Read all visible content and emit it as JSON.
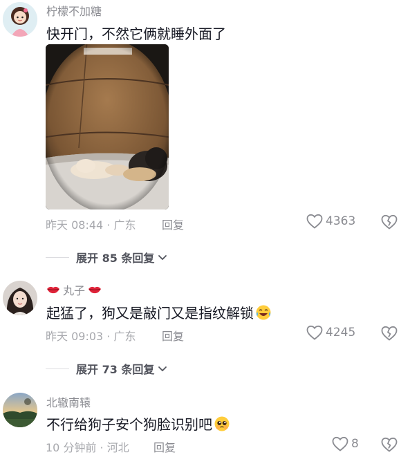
{
  "comments": [
    {
      "username": "柠檬不加糖",
      "text": "快开门，不然它俩就睡外面了",
      "time": "昨天 08:44",
      "location": "· 广东",
      "reply_label": "回复",
      "likes": "4363",
      "expand_label": "展开 85 条回复",
      "avatar_icon": "cartoon-girl-avatar-icon",
      "has_image": true
    },
    {
      "username": "丸子",
      "text": "起猛了，狗又是敲门又是指纹解锁",
      "time": "昨天 09:03",
      "location": "· 广东",
      "reply_label": "回复",
      "likes": "4245",
      "expand_label": "展开 73 条回复",
      "avatar_icon": "girl-photo-avatar-icon",
      "emoji": "laughing-crying-emoji-icon"
    },
    {
      "username": "北辙南辕",
      "text": "不行给狗子安个狗脸识别吧",
      "time": "10 分钟前",
      "location": "· 河北",
      "reply_label": "回复",
      "likes": "8",
      "avatar_icon": "landscape-avatar-icon",
      "emoji": "pleading-face-emoji-icon"
    }
  ],
  "colors": {
    "text_primary": "#161823",
    "text_secondary": "#8a8b91",
    "lips_red": "#e0243a"
  }
}
